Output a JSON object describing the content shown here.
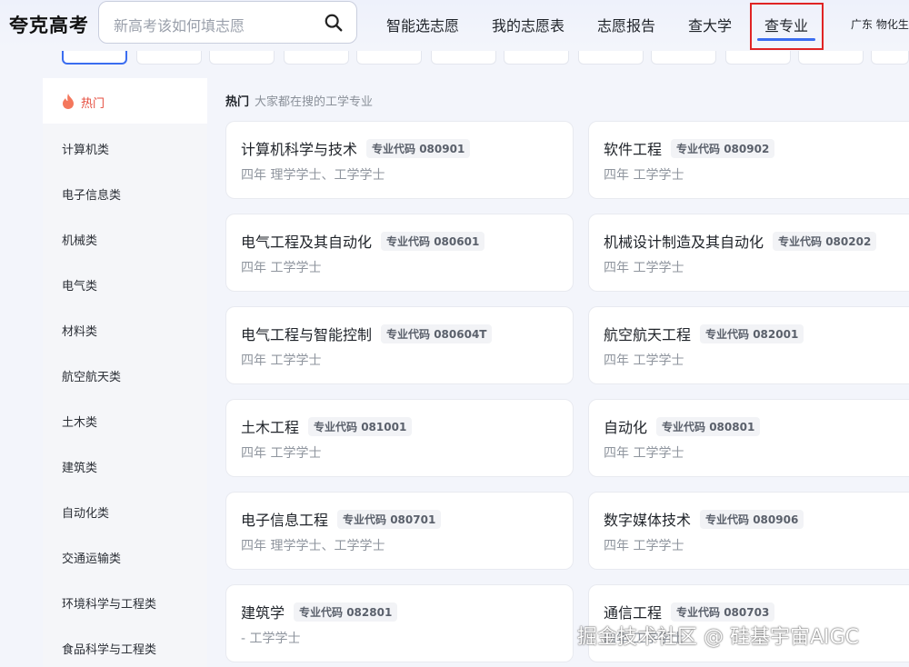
{
  "header": {
    "logo": "夸克高考",
    "search_placeholder": "新高考该如何填志愿",
    "nav": [
      "智能选志愿",
      "我的志愿表",
      "志愿报告",
      "查大学",
      "查专业"
    ],
    "active_nav": "查专业",
    "region": "广东 物化生"
  },
  "sidebar": {
    "hot_label": "热门",
    "items": [
      "计算机类",
      "电子信息类",
      "机械类",
      "电气类",
      "材料类",
      "航空航天类",
      "土木类",
      "建筑类",
      "自动化类",
      "交通运输类",
      "环境科学与工程类",
      "食品科学与工程类"
    ]
  },
  "main": {
    "section_title": "热门",
    "section_subtitle": "大家都在搜的工学专业",
    "code_prefix": "专业代码",
    "cards": [
      {
        "name": "计算机科学与技术",
        "code": "专业代码 080901",
        "meta": "四年  理学学士、工学学士"
      },
      {
        "name": "软件工程",
        "code": "专业代码 080902",
        "meta": "四年  工学学士"
      },
      {
        "name": "电气工程及其自动化",
        "code": "专业代码 080601",
        "meta": "四年  工学学士"
      },
      {
        "name": "机械设计制造及其自动化",
        "code": "专业代码 080202",
        "meta": "四年  工学学士"
      },
      {
        "name": "电气工程与智能控制",
        "code": "专业代码 080604T",
        "meta": "四年  工学学士"
      },
      {
        "name": "航空航天工程",
        "code": "专业代码 082001",
        "meta": "四年  工学学士"
      },
      {
        "name": "土木工程",
        "code": "专业代码 081001",
        "meta": "四年  工学学士"
      },
      {
        "name": "自动化",
        "code": "专业代码 080801",
        "meta": "四年  工学学士"
      },
      {
        "name": "电子信息工程",
        "code": "专业代码 080701",
        "meta": "四年  理学学士、工学学士"
      },
      {
        "name": "数字媒体技术",
        "code": "专业代码 080906",
        "meta": "四年  工学学士"
      },
      {
        "name": "建筑学",
        "code": "专业代码 082801",
        "meta": "-  工学学士"
      },
      {
        "name": "通信工程",
        "code": "专业代码 080703",
        "meta": "四年  工学学士"
      }
    ]
  },
  "watermark": "掘金技术社区 @ 硅基宇宙AIGC",
  "colors": {
    "accent": "#3b6df0",
    "hot": "#e54b3c",
    "highlight_box": "#e02424"
  }
}
